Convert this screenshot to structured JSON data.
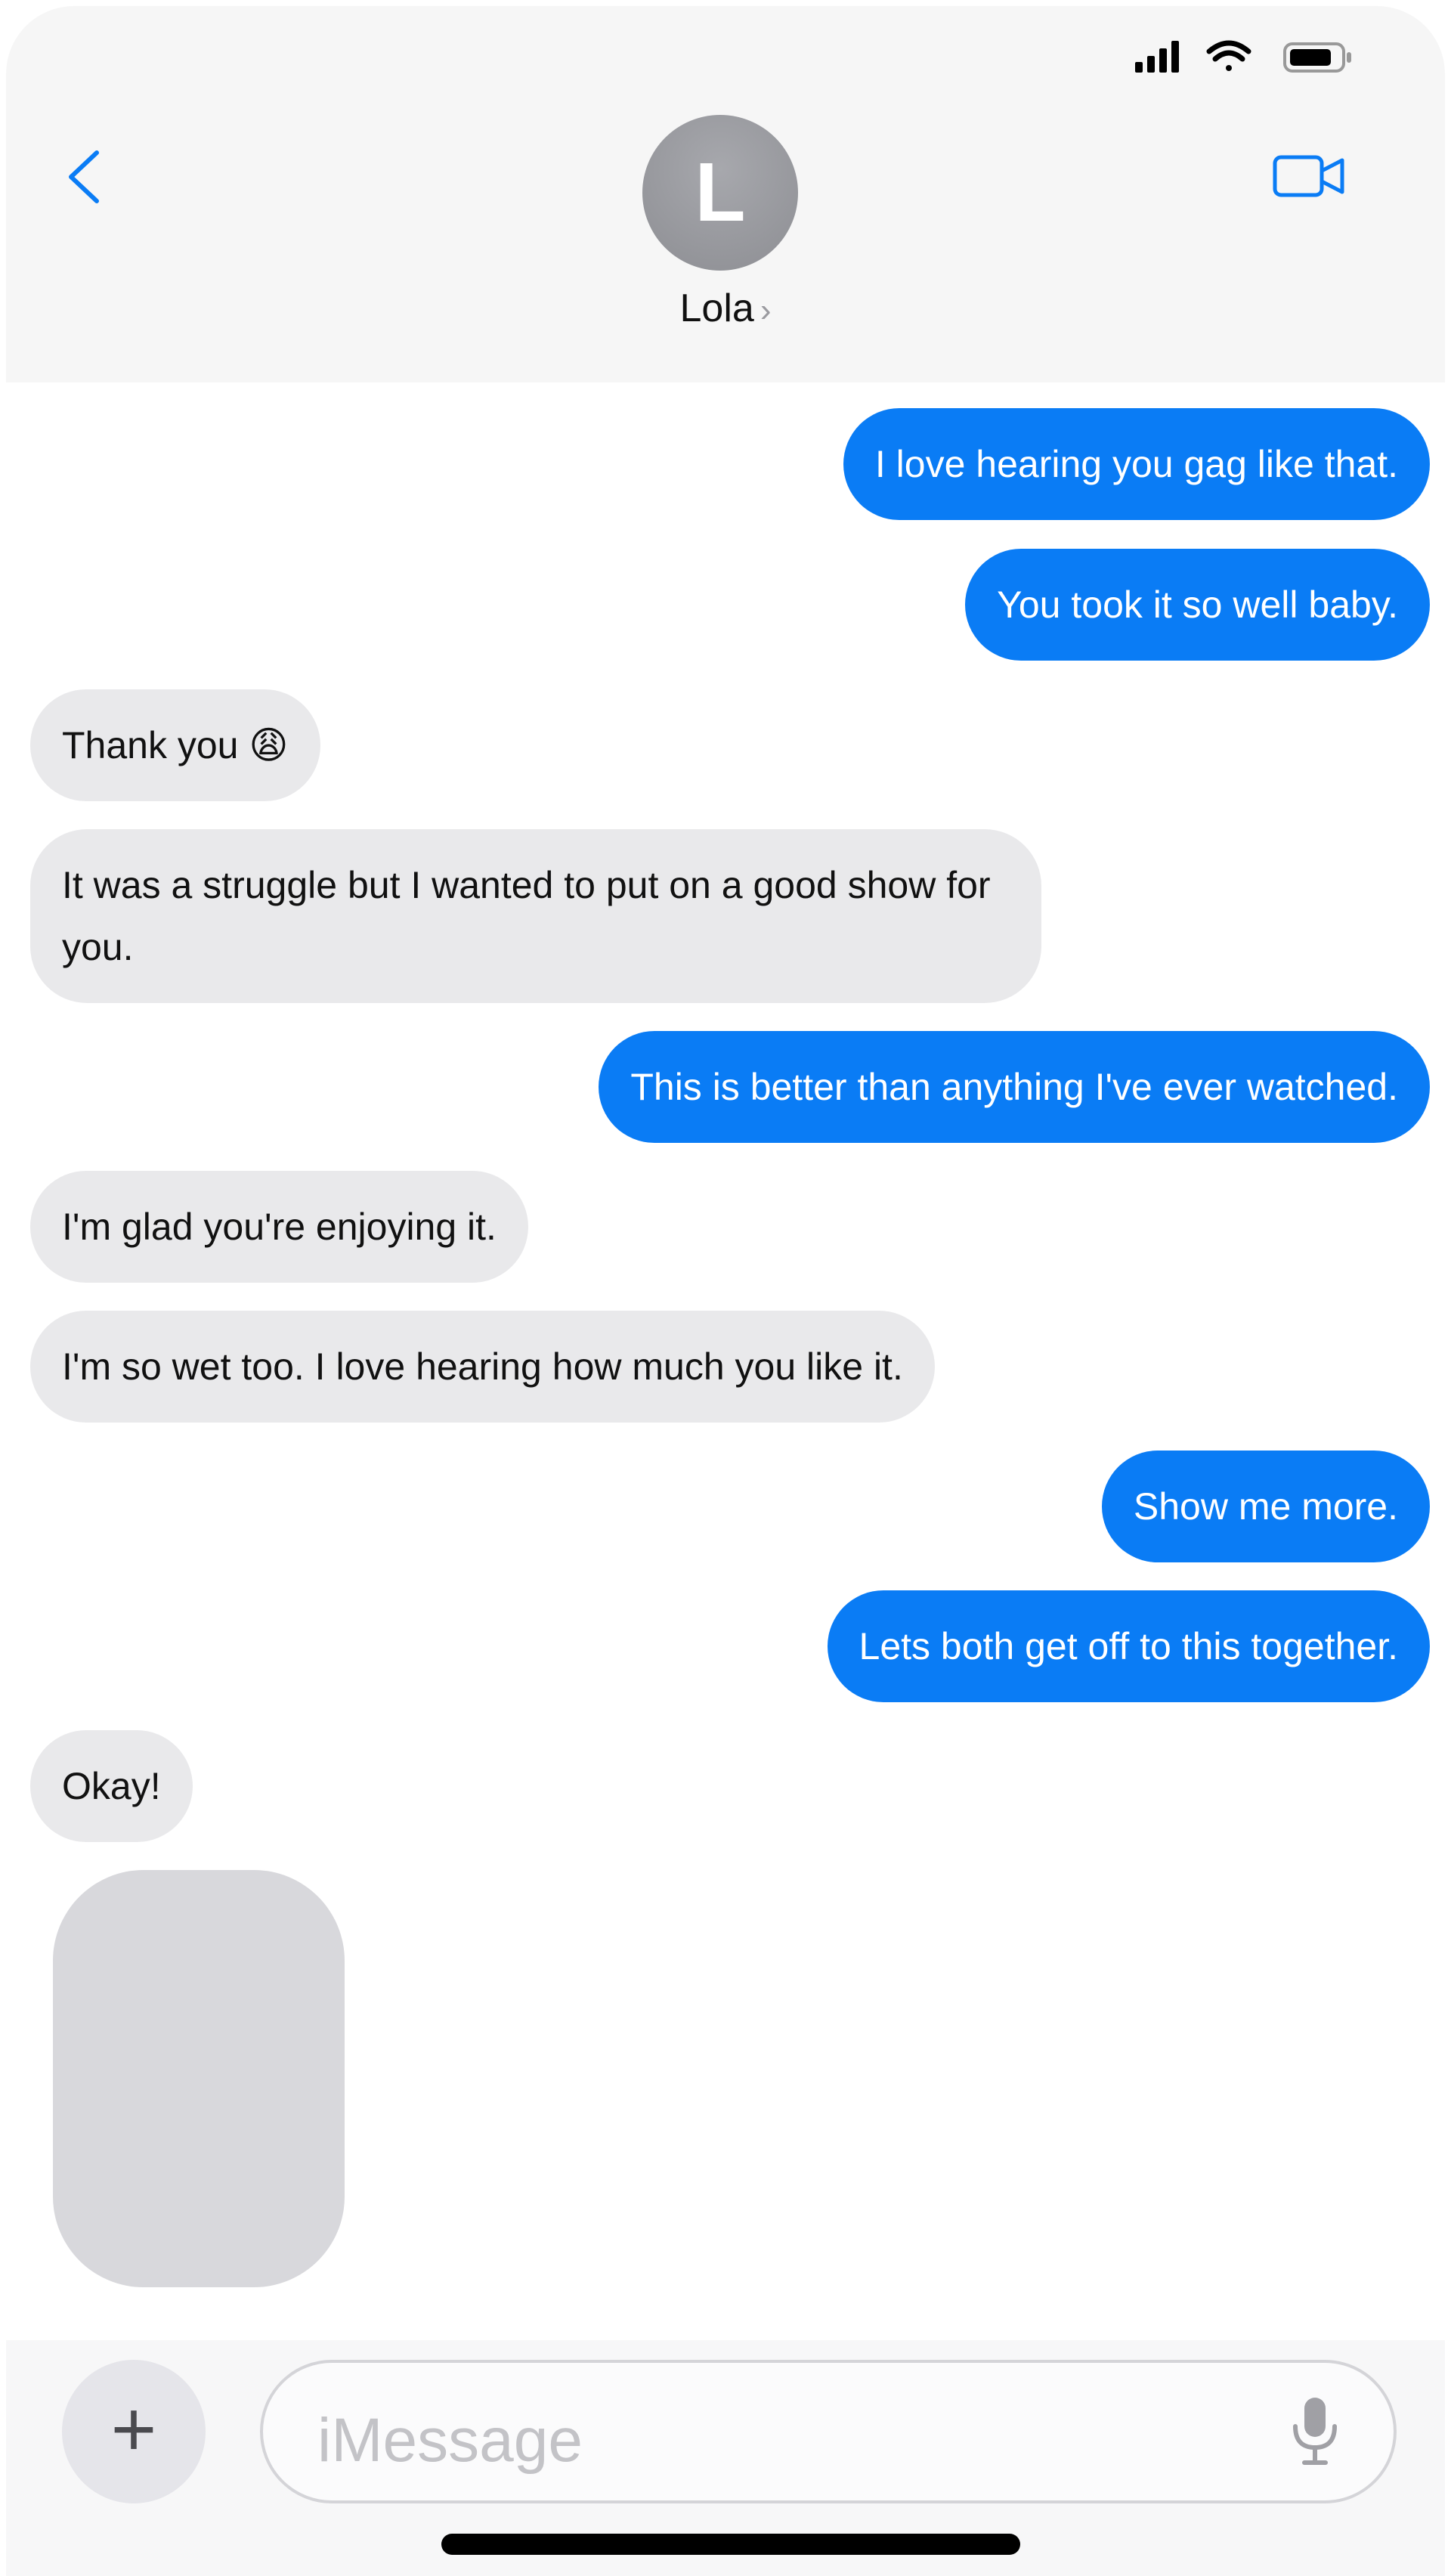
{
  "contact": {
    "initial": "L",
    "name": "Lola",
    "chevron": "›"
  },
  "status_bar": {
    "signal_icon": "cellular-signal-icon",
    "wifi_icon": "wifi-icon",
    "battery_icon": "battery-icon"
  },
  "navigation": {
    "back_icon": "back-chevron-icon",
    "video_icon": "video-call-icon"
  },
  "messages": [
    {
      "side": "out",
      "text": "I love hearing you gag like that."
    },
    {
      "side": "out",
      "text": "You took it so well baby."
    },
    {
      "side": "in",
      "text": "Thank you 😩"
    },
    {
      "side": "in",
      "text": "It was a struggle but I wanted to put on a good show for you."
    },
    {
      "side": "out",
      "text": "This is better than anything I've ever watched."
    },
    {
      "side": "in",
      "text": "I'm glad you're enjoying it."
    },
    {
      "side": "in",
      "text": "I'm so wet too. I love hearing how much you like it."
    },
    {
      "side": "out",
      "text": "Show me more."
    },
    {
      "side": "out",
      "text": "Lets both get off to this together."
    },
    {
      "side": "in",
      "text": "Okay!"
    }
  ],
  "composer": {
    "plus_label": "+",
    "placeholder": "iMessage",
    "plus_icon": "plus-icon",
    "mic_icon": "microphone-icon"
  },
  "colors": {
    "outgoing": "#0a7cf5",
    "incoming": "#e9e9eb",
    "header": "#f6f6f6"
  }
}
